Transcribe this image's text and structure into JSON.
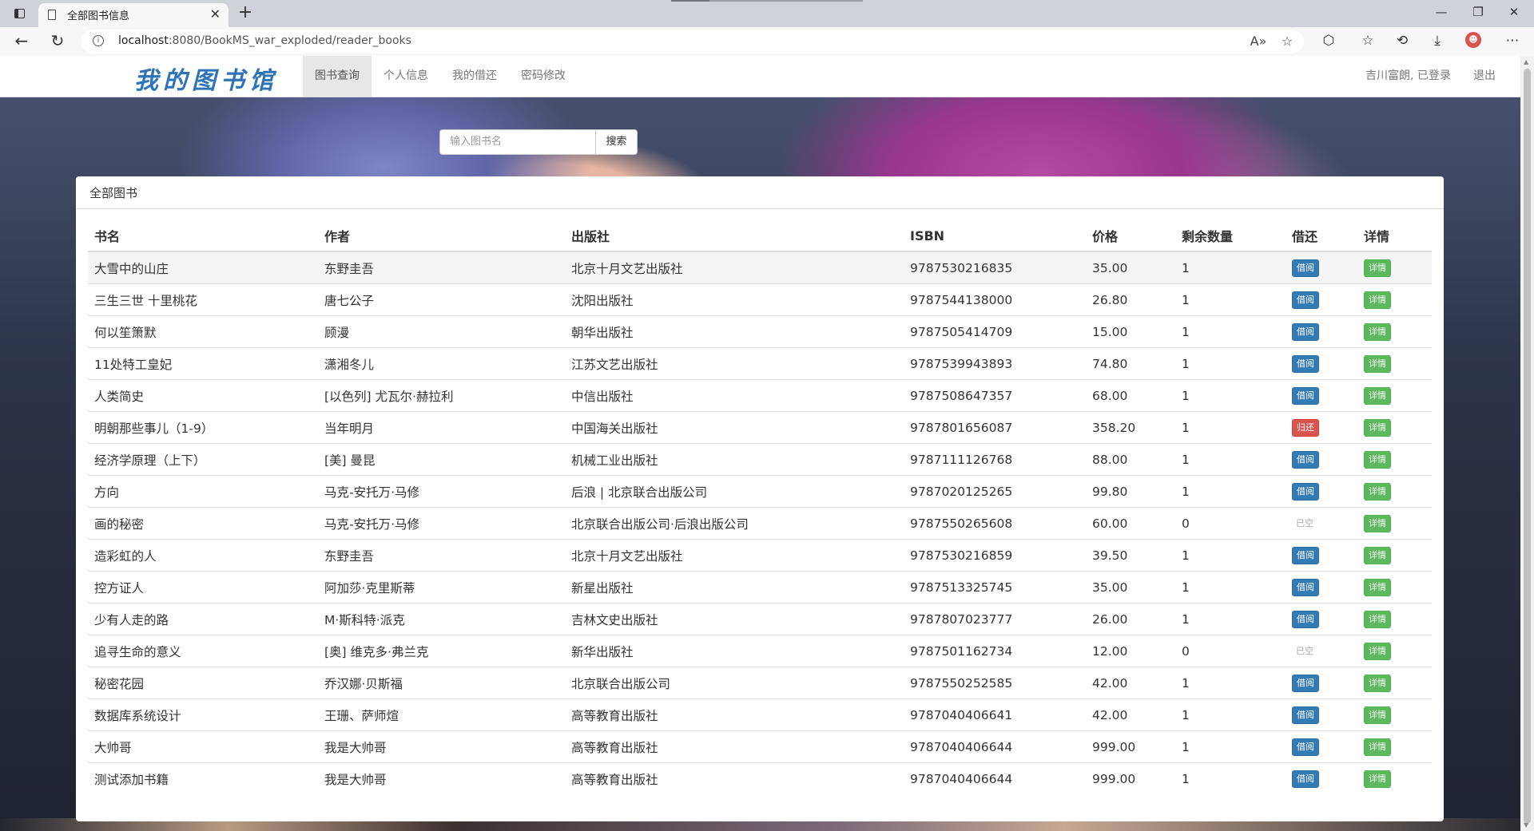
{
  "browser": {
    "tab_title": "全部图书信息",
    "url_host": "localhost",
    "url_rest": ":8080/BookMS_war_exploded/reader_books"
  },
  "navbar": {
    "brand": "我的图书馆",
    "links": [
      "图书查询",
      "个人信息",
      "我的借还",
      "密码修改"
    ],
    "user": "吉川富朗, 已登录",
    "logout": "退出"
  },
  "search": {
    "placeholder": "输入图书名",
    "button": "搜索"
  },
  "panel": {
    "heading": "全部图书",
    "columns": [
      "书名",
      "作者",
      "出版社",
      "ISBN",
      "价格",
      "剩余数量",
      "借还",
      "详情"
    ],
    "rows": [
      {
        "name": "大雪中的山庄",
        "author": "东野圭吾",
        "publisher": "北京十月文艺出版社",
        "isbn": "9787530216835",
        "price": "35.00",
        "count": "1",
        "action": "借阅",
        "action_type": "borrow",
        "detail": "详情"
      },
      {
        "name": "三生三世 十里桃花",
        "author": "唐七公子",
        "publisher": "沈阳出版社",
        "isbn": "9787544138000",
        "price": "26.80",
        "count": "1",
        "action": "借阅",
        "action_type": "borrow",
        "detail": "详情"
      },
      {
        "name": "何以笙箫默",
        "author": "顾漫",
        "publisher": "朝华出版社",
        "isbn": "9787505414709",
        "price": "15.00",
        "count": "1",
        "action": "借阅",
        "action_type": "borrow",
        "detail": "详情"
      },
      {
        "name": "11处特工皇妃",
        "author": "潇湘冬儿",
        "publisher": "江苏文艺出版社",
        "isbn": "9787539943893",
        "price": "74.80",
        "count": "1",
        "action": "借阅",
        "action_type": "borrow",
        "detail": "详情"
      },
      {
        "name": "人类简史",
        "author": "[以色列] 尤瓦尔·赫拉利",
        "publisher": "中信出版社",
        "isbn": "9787508647357",
        "price": "68.00",
        "count": "1",
        "action": "借阅",
        "action_type": "borrow",
        "detail": "详情"
      },
      {
        "name": "明朝那些事儿（1-9）",
        "author": "当年明月",
        "publisher": "中国海关出版社",
        "isbn": "9787801656087",
        "price": "358.20",
        "count": "1",
        "action": "归还",
        "action_type": "return",
        "detail": "详情"
      },
      {
        "name": "经济学原理（上下）",
        "author": "[美] 曼昆",
        "publisher": "机械工业出版社",
        "isbn": "9787111126768",
        "price": "88.00",
        "count": "1",
        "action": "借阅",
        "action_type": "borrow",
        "detail": "详情"
      },
      {
        "name": "方向",
        "author": "马克-安托万·马修",
        "publisher": "后浪 | 北京联合出版公司",
        "isbn": "9787020125265",
        "price": "99.80",
        "count": "1",
        "action": "借阅",
        "action_type": "borrow",
        "detail": "详情"
      },
      {
        "name": "画的秘密",
        "author": "马克-安托万·马修",
        "publisher": "北京联合出版公司·后浪出版公司",
        "isbn": "9787550265608",
        "price": "60.00",
        "count": "0",
        "action": "已空",
        "action_type": "empty",
        "detail": "详情"
      },
      {
        "name": "造彩虹的人",
        "author": "东野圭吾",
        "publisher": "北京十月文艺出版社",
        "isbn": "9787530216859",
        "price": "39.50",
        "count": "1",
        "action": "借阅",
        "action_type": "borrow",
        "detail": "详情"
      },
      {
        "name": "控方证人",
        "author": "阿加莎·克里斯蒂",
        "publisher": "新星出版社",
        "isbn": "9787513325745",
        "price": "35.00",
        "count": "1",
        "action": "借阅",
        "action_type": "borrow",
        "detail": "详情"
      },
      {
        "name": "少有人走的路",
        "author": "M·斯科特·派克",
        "publisher": "吉林文史出版社",
        "isbn": "9787807023777",
        "price": "26.00",
        "count": "1",
        "action": "借阅",
        "action_type": "borrow",
        "detail": "详情"
      },
      {
        "name": "追寻生命的意义",
        "author": "[奥] 维克多·弗兰克",
        "publisher": "新华出版社",
        "isbn": "9787501162734",
        "price": "12.00",
        "count": "0",
        "action": "已空",
        "action_type": "empty",
        "detail": "详情"
      },
      {
        "name": "秘密花园",
        "author": "乔汉娜·贝斯福",
        "publisher": "北京联合出版公司",
        "isbn": "9787550252585",
        "price": "42.00",
        "count": "1",
        "action": "借阅",
        "action_type": "borrow",
        "detail": "详情"
      },
      {
        "name": "数据库系统设计",
        "author": "王珊、萨师煊",
        "publisher": "高等教育出版社",
        "isbn": "9787040406641",
        "price": "42.00",
        "count": "1",
        "action": "借阅",
        "action_type": "borrow",
        "detail": "详情"
      },
      {
        "name": "大帅哥",
        "author": "我是大帅哥",
        "publisher": "高等教育出版社",
        "isbn": "9787040406644",
        "price": "999.00",
        "count": "1",
        "action": "借阅",
        "action_type": "borrow",
        "detail": "详情"
      },
      {
        "name": "测试添加书籍",
        "author": "我是大帅哥",
        "publisher": "高等教育出版社",
        "isbn": "9787040406644",
        "price": "999.00",
        "count": "1",
        "action": "借阅",
        "action_type": "borrow",
        "detail": "详情"
      }
    ]
  },
  "colors": {
    "brand": "#2e73b8",
    "borrow": "#337ab7",
    "return": "#d9534f",
    "detail": "#5cb85c"
  }
}
